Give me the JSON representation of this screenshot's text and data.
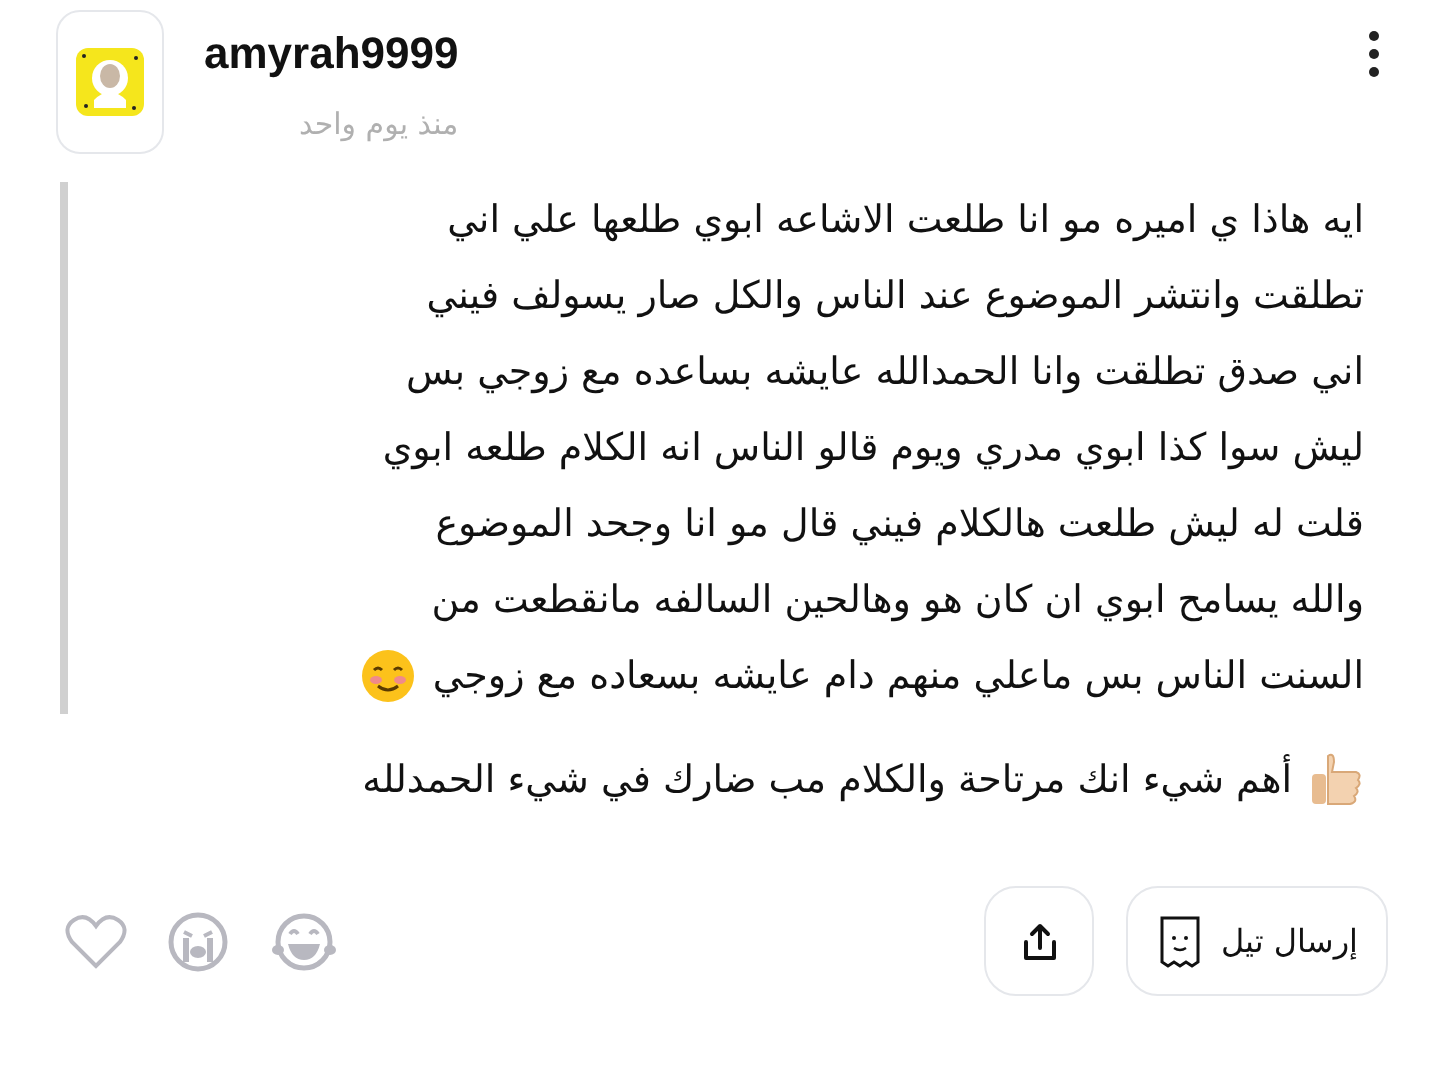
{
  "post": {
    "username": "amyrah9999",
    "time": "منذ يوم واحد"
  },
  "quote_lines": [
    "ايه هاذا ي اميره مو انا طلعت الاشاعه ابوي طلعها علي اني",
    "تطلقت وانتشر الموضوع عند الناس والكل صار يسولف فيني",
    "اني صدق تطلقت وانا الحمدالله عايشه بساعده مع زوجي بس",
    "ليش سوا كذا ابوي مدري ويوم قالو الناس انه الكلام طلعه ابوي",
    "قلت له ليش طلعت هالكلام فيني قال مو انا وجحد الموضوع",
    "والله يسامح ابوي ان كان هو وهالحين السالفه مانقطعت من",
    "السنت الناس بس ماعلي منهم دام عايشه بسعاده مع زوجي"
  ],
  "reply": "أهم شيء انك مرتاحة والكلام مب ضارك في شيء الحمدلله",
  "actions": {
    "send_label": "إرسال تيل",
    "liked": false
  }
}
